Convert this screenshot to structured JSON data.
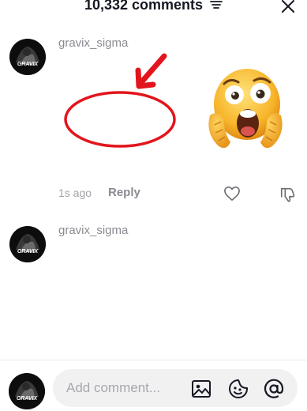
{
  "header": {
    "title": "10,332 comments"
  },
  "comments": [
    {
      "username": "gravix_sigma",
      "time": "1s ago",
      "reply_label": "Reply",
      "avatar_text": "GRAVIX"
    },
    {
      "username": "gravix_sigma",
      "avatar_text": "GRAVIX"
    }
  ],
  "composer": {
    "placeholder": "Add comment...",
    "avatar_text": "GRAVIX"
  },
  "annotation": {
    "ellipse_color": "#e3151c",
    "arrow_color": "#e3151c"
  },
  "icons": [
    "filter-icon",
    "close-icon",
    "heart-icon",
    "dislike-icon",
    "image-icon",
    "emoji-icon",
    "mention-icon"
  ]
}
